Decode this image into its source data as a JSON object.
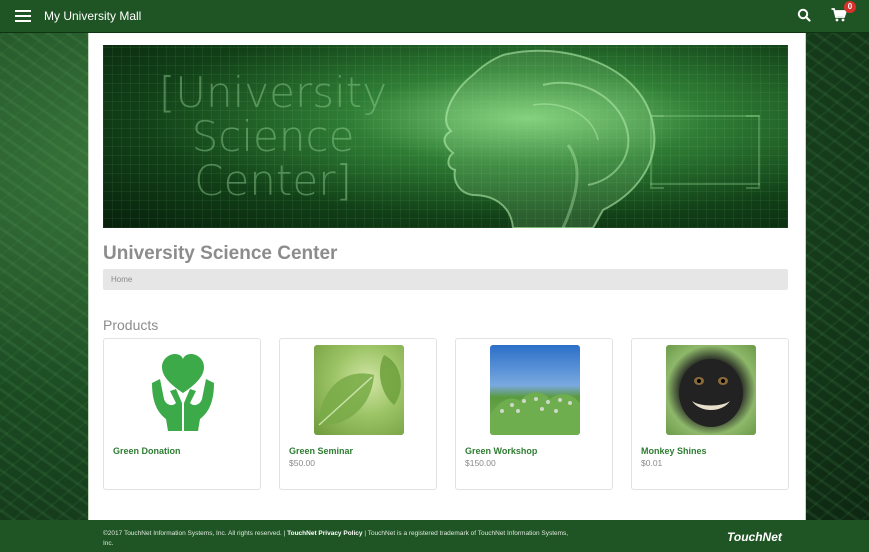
{
  "header": {
    "title": "My University Mall",
    "cart_count": "0"
  },
  "banner": {
    "line1": "[University",
    "line2": "Science",
    "line3": "Center]"
  },
  "store": {
    "title": "University Science Center",
    "breadcrumb": "Home",
    "products_heading": "Products"
  },
  "products": [
    {
      "name": "Green Donation",
      "price": ""
    },
    {
      "name": "Green Seminar",
      "price": "$50.00"
    },
    {
      "name": "Green Workshop",
      "price": "$150.00"
    },
    {
      "name": "Monkey Shines",
      "price": "$0.01"
    }
  ],
  "footer": {
    "copyright": "©2017 TouchNet Information Systems, Inc. All rights reserved. |",
    "privacy_link": "TouchNet Privacy Policy",
    "trademark": "| TouchNet is a registered trademark of TouchNet Information Systems, Inc.",
    "logo": "TouchNet"
  },
  "colors": {
    "header_green": "#1f5424",
    "product_name_green": "#2e7d32",
    "heart_green": "#3daa4a",
    "badge_red": "#d9302c"
  },
  "icons": [
    "menu-icon",
    "search-icon",
    "cart-icon",
    "heart-hands-icon"
  ]
}
